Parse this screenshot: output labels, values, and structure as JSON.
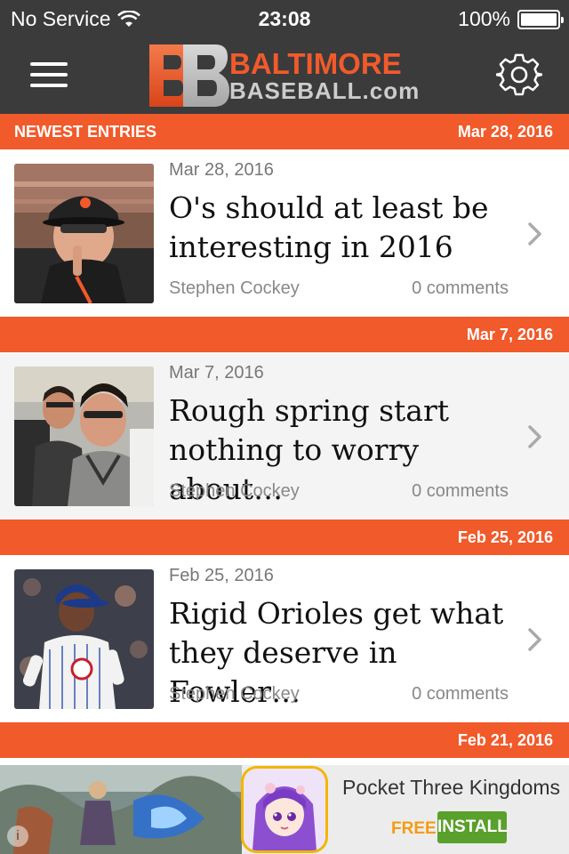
{
  "status_bar": {
    "carrier": "No Service",
    "time": "23:08",
    "battery": "100%"
  },
  "nav": {
    "logo_mark": "BB",
    "logo_top": "BALTIMORE",
    "logo_bottom": "BASEBALL.com",
    "menu_icon": "hamburger-icon",
    "settings_icon": "gear-icon"
  },
  "section": {
    "label": "NEWEST ENTRIES",
    "date": "Mar 28, 2016"
  },
  "colors": {
    "accent": "#f15a2b",
    "navbar": "#3b3b3b"
  },
  "articles": [
    {
      "date": "Mar 28, 2016",
      "title": "O's should at least be\ninteresting in 2016",
      "author": "Stephen Cockey",
      "comments": "0 comments"
    },
    {
      "header_date": "Mar 7, 2016",
      "date": "Mar 7, 2016",
      "title": "Rough spring start\nnothing to worry about…",
      "author": "Stephen Cockey",
      "comments": "0 comments"
    },
    {
      "header_date": "Feb 25, 2016",
      "date": "Feb 25, 2016",
      "title": "Rigid Orioles get what\nthey deserve in Fowler…",
      "author": "Stephen Cockey",
      "comments": "0 comments"
    }
  ],
  "next_header_date": "Feb 21, 2016",
  "ad": {
    "title": "Pocket Three Kingdoms",
    "price": "FREE",
    "install": "INSTALL",
    "info": "i"
  }
}
